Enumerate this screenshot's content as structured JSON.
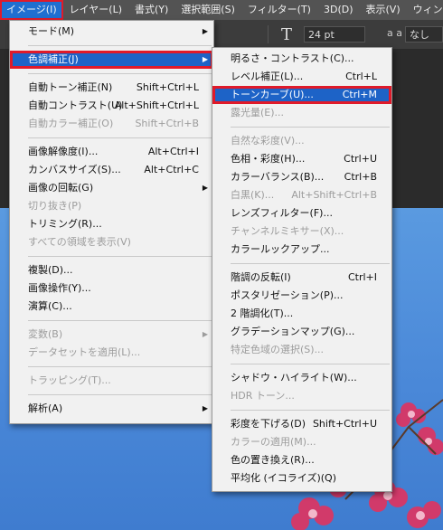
{
  "menubar": {
    "items": [
      "イメージ(I)",
      "レイヤー(L)",
      "書式(Y)",
      "選択範囲(S)",
      "フィルター(T)",
      "3D(D)",
      "表示(V)",
      "ウィンド"
    ]
  },
  "options_bar": {
    "font_size": "24 pt",
    "aa_label": "a a",
    "aa_value": "なし"
  },
  "image_menu": {
    "items": [
      {
        "label": "モード(M)",
        "submenu": true
      },
      {
        "label": "色調補正(J)",
        "submenu": true,
        "highlighted": true
      },
      {
        "label": "自動トーン補正(N)",
        "shortcut": "Shift+Ctrl+L"
      },
      {
        "label": "自動コントラスト(U)",
        "shortcut": "Alt+Shift+Ctrl+L"
      },
      {
        "label": "自動カラー補正(O)",
        "shortcut": "Shift+Ctrl+B",
        "disabled": true
      },
      {
        "label": "画像解像度(I)...",
        "shortcut": "Alt+Ctrl+I"
      },
      {
        "label": "カンバスサイズ(S)...",
        "shortcut": "Alt+Ctrl+C"
      },
      {
        "label": "画像の回転(G)",
        "submenu": true
      },
      {
        "label": "切り抜き(P)",
        "disabled": true
      },
      {
        "label": "トリミング(R)..."
      },
      {
        "label": "すべての領域を表示(V)",
        "disabled": true
      },
      {
        "label": "複製(D)..."
      },
      {
        "label": "画像操作(Y)..."
      },
      {
        "label": "演算(C)..."
      },
      {
        "label": "変数(B)",
        "submenu": true,
        "disabled": true
      },
      {
        "label": "データセットを適用(L)...",
        "disabled": true
      },
      {
        "label": "トラッピング(T)...",
        "disabled": true
      },
      {
        "label": "解析(A)",
        "submenu": true
      }
    ]
  },
  "adjust_menu": {
    "items": [
      {
        "label": "明るさ・コントラスト(C)..."
      },
      {
        "label": "レベル補正(L)...",
        "shortcut": "Ctrl+L"
      },
      {
        "label": "トーンカーブ(U)...",
        "shortcut": "Ctrl+M",
        "highlighted": true
      },
      {
        "label": "露光量(E)...",
        "disabled": true
      },
      {
        "label": "自然な彩度(V)...",
        "disabled": true
      },
      {
        "label": "色相・彩度(H)...",
        "shortcut": "Ctrl+U"
      },
      {
        "label": "カラーバランス(B)...",
        "shortcut": "Ctrl+B"
      },
      {
        "label": "白黒(K)...",
        "shortcut": "Alt+Shift+Ctrl+B",
        "disabled": true
      },
      {
        "label": "レンズフィルター(F)..."
      },
      {
        "label": "チャンネルミキサー(X)...",
        "disabled": true
      },
      {
        "label": "カラールックアップ..."
      },
      {
        "label": "階調の反転(I)",
        "shortcut": "Ctrl+I"
      },
      {
        "label": "ポスタリゼーション(P)..."
      },
      {
        "label": "2 階調化(T)..."
      },
      {
        "label": "グラデーションマップ(G)..."
      },
      {
        "label": "特定色域の選択(S)...",
        "disabled": true
      },
      {
        "label": "シャドウ・ハイライト(W)..."
      },
      {
        "label": "HDR トーン...",
        "disabled": true
      },
      {
        "label": "彩度を下げる(D)",
        "shortcut": "Shift+Ctrl+U"
      },
      {
        "label": "カラーの適用(M)...",
        "disabled": true
      },
      {
        "label": "色の置き換え(R)..."
      },
      {
        "label": "平均化 (イコライズ)(Q)"
      }
    ]
  }
}
